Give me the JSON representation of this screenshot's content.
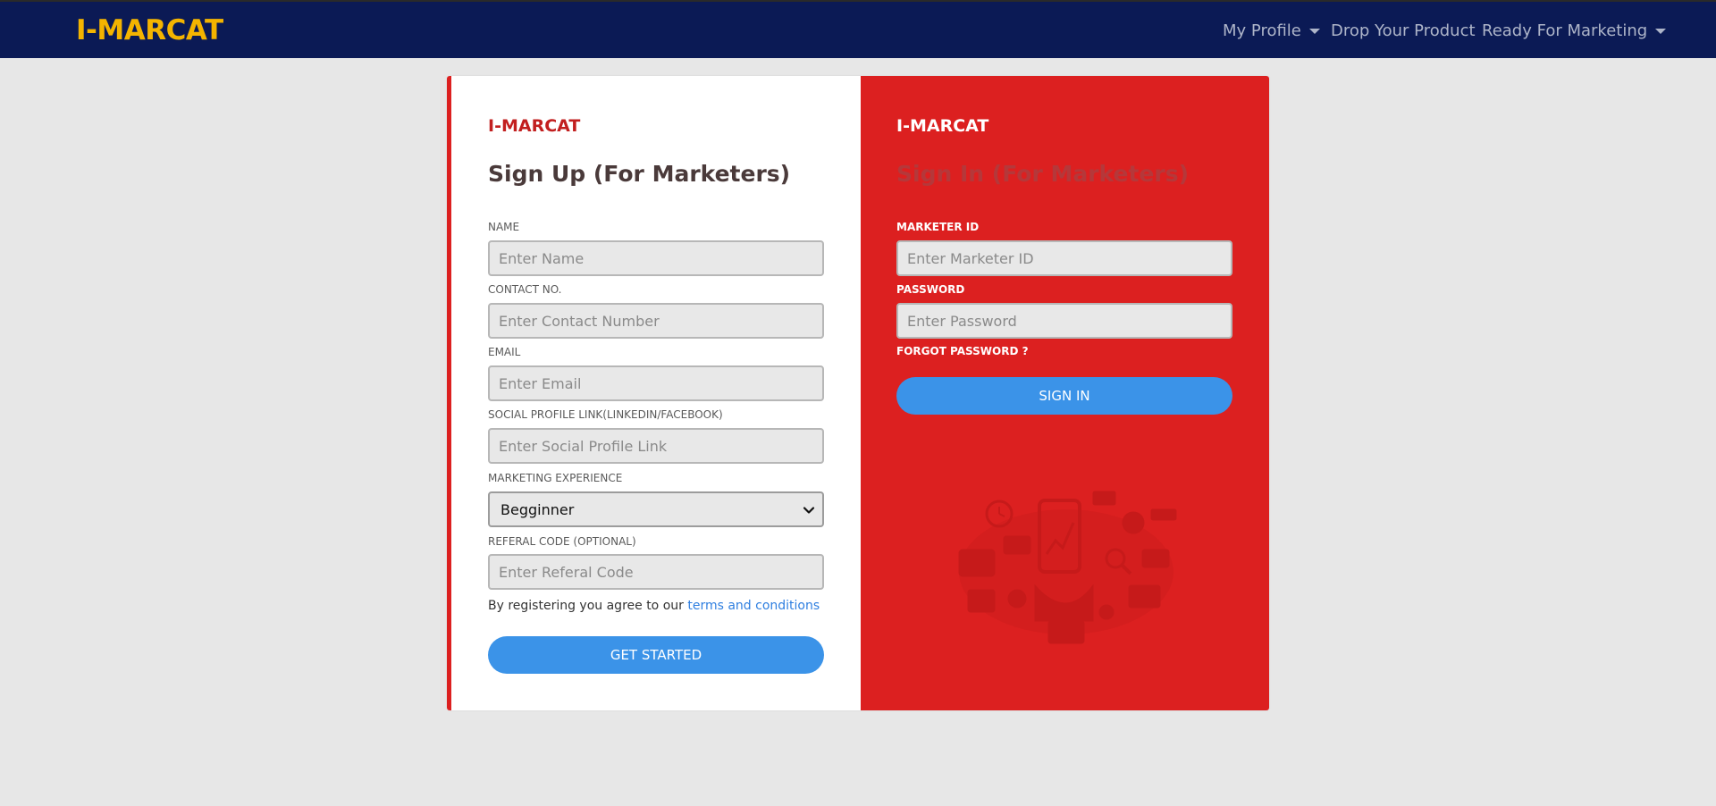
{
  "navbar": {
    "brand": "I-MARCAT",
    "items": [
      {
        "label": "My Profile",
        "dropdown": true
      },
      {
        "label": "Drop Your Product",
        "dropdown": false
      },
      {
        "label": "Ready For Marketing",
        "dropdown": true
      }
    ]
  },
  "signup": {
    "brand": "I-MARCAT",
    "title": "Sign Up (For Marketers)",
    "name_label": "NAME",
    "name_placeholder": "Enter Name",
    "contact_label": "CONTACT NO.",
    "contact_placeholder": "Enter Contact Number",
    "email_label": "EMAIL",
    "email_placeholder": "Enter Email",
    "social_label": "SOCIAL PROFILE LINK(LINKEDIN/FACEBOOK)",
    "social_placeholder": "Enter Social Profile Link",
    "experience_label": "MARKETING EXPERIENCE",
    "experience_value": "Begginner",
    "referal_label": "REFERAL CODE (OPTIONAL)",
    "referal_placeholder": "Enter Referal Code",
    "agree_text": "By registering you agree to our ",
    "agree_link": "terms and conditions",
    "button": "GET STARTED"
  },
  "signin": {
    "brand": "I-MARCAT",
    "title": "Sign In (For Marketers)",
    "id_label": "MARKETER ID",
    "id_placeholder": "Enter Marketer ID",
    "password_label": "PASSWORD",
    "password_placeholder": "Enter Password",
    "forgot": "FORGOT PASSWORD ?",
    "button": "SIGN IN"
  },
  "colors": {
    "navbar_bg": "#0b1a55",
    "brand_yellow": "#f4b400",
    "accent_red": "#dc2020",
    "button_blue": "#3b93e8",
    "page_bg": "#e7e7e7"
  }
}
